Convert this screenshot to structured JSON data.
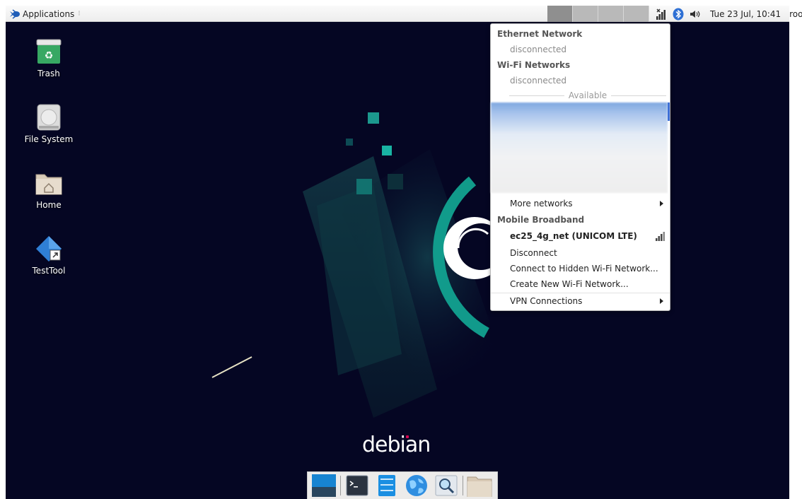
{
  "panel": {
    "apps_label": "Applications",
    "apps_handle": "⁝",
    "workspace_count": 4,
    "clock": "Tue 23 Jul, 10:41",
    "user": "root"
  },
  "desktop_icons": [
    {
      "label": "Trash",
      "icon": "trash-icon"
    },
    {
      "label": "File System",
      "icon": "drive-icon"
    },
    {
      "label": "Home",
      "icon": "home-folder-icon"
    },
    {
      "label": "TestTool",
      "icon": "testtool-icon"
    }
  ],
  "wallpaper": {
    "brand": "debian"
  },
  "network_menu": {
    "ethernet_header": "Ethernet Network",
    "ethernet_status": "disconnected",
    "wifi_header": "Wi-Fi Networks",
    "wifi_status": "disconnected",
    "available_label": "Available",
    "more_networks": "More networks",
    "mobile_header": "Mobile Broadband",
    "mobile_connection": "ec25_4g_net (UNICOM LTE)",
    "disconnect": "Disconnect",
    "connect_hidden": "Connect to Hidden Wi-Fi Network...",
    "create_new": "Create New Wi-Fi Network...",
    "vpn": "VPN Connections"
  },
  "dock_items": [
    "show-desktop",
    "terminal",
    "file-manager",
    "web-browser",
    "app-finder",
    "home-folder"
  ],
  "colors": {
    "desktop_bg": "#050623",
    "wallpaper_accent": "#12a290",
    "debian_red": "#d70751"
  }
}
